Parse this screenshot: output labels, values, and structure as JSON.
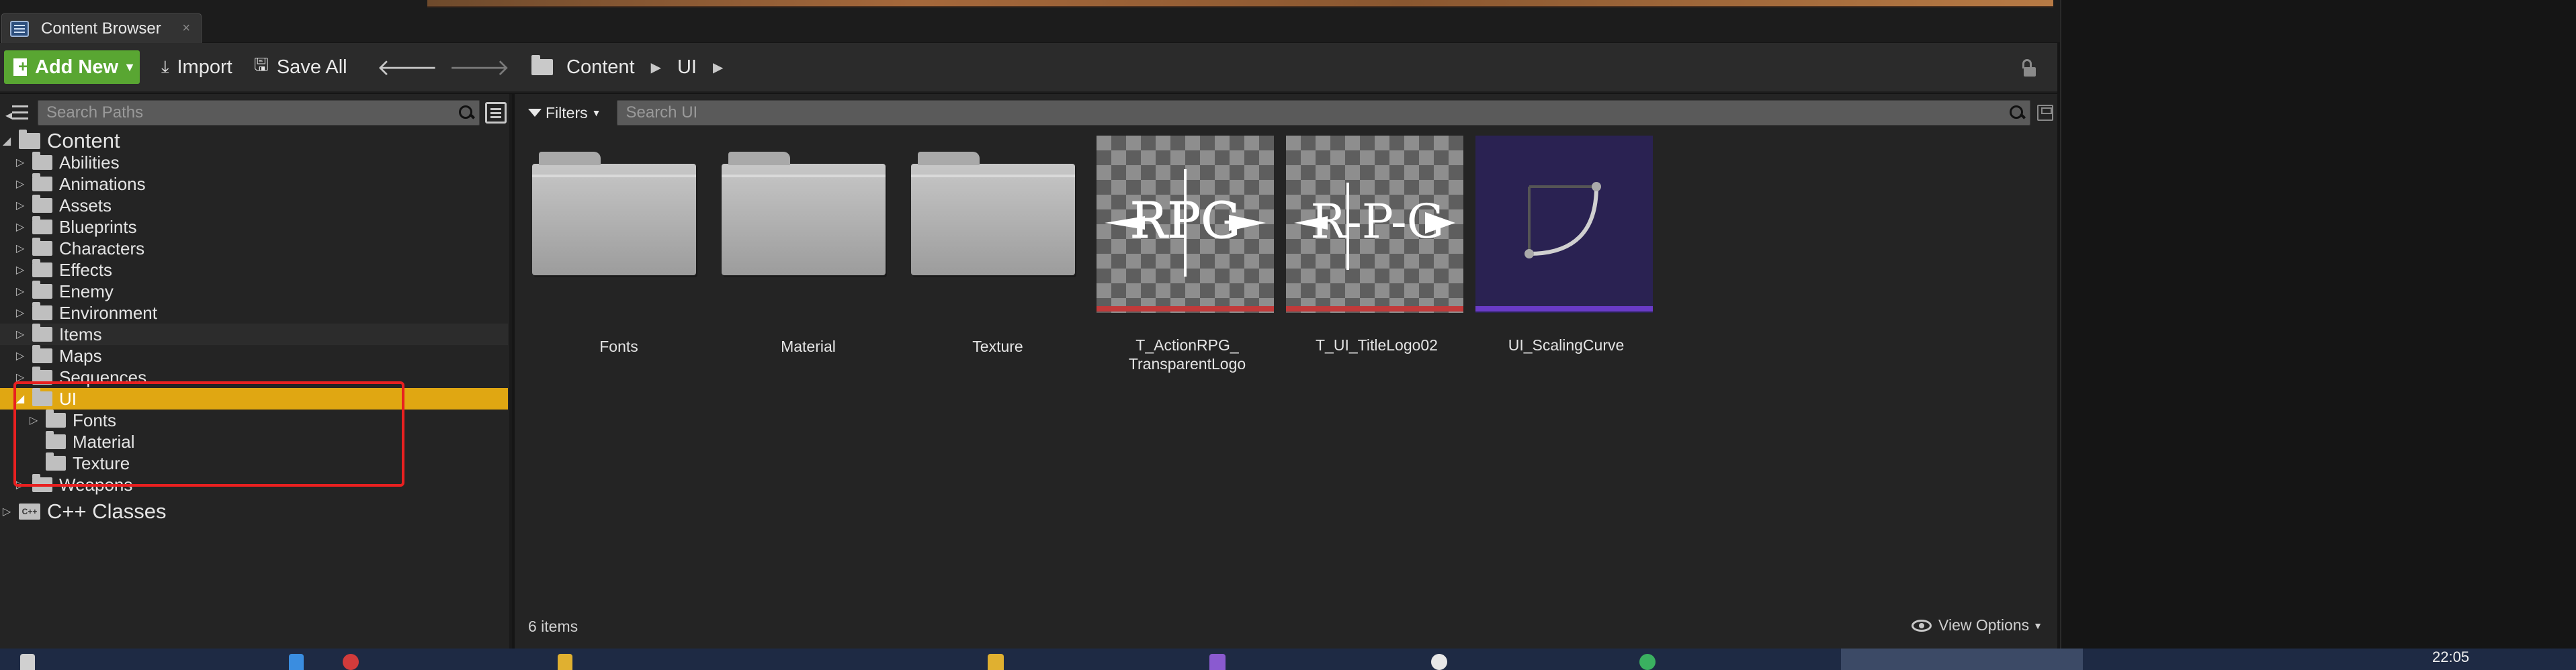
{
  "tab": {
    "title": "Content Browser",
    "close": "×"
  },
  "toolbar": {
    "add_new": "Add New",
    "import": "Import",
    "save_all": "Save All",
    "back": "🡐",
    "forward": "🡒",
    "breadcrumbs": [
      "Content",
      "UI"
    ],
    "crumb_sep": "▶"
  },
  "paths": {
    "search_placeholder": "Search Paths",
    "tree": [
      {
        "label": "Content",
        "level": 0,
        "expanded": true
      },
      {
        "label": "Abilities",
        "level": 1
      },
      {
        "label": "Animations",
        "level": 1
      },
      {
        "label": "Assets",
        "level": 1
      },
      {
        "label": "Blueprints",
        "level": 1
      },
      {
        "label": "Characters",
        "level": 1
      },
      {
        "label": "Effects",
        "level": 1
      },
      {
        "label": "Enemy",
        "level": 1
      },
      {
        "label": "Environment",
        "level": 1
      },
      {
        "label": "Items",
        "level": 1
      },
      {
        "label": "Maps",
        "level": 1
      },
      {
        "label": "Sequences",
        "level": 1
      },
      {
        "label": "UI",
        "level": 1,
        "expanded": true,
        "selected": true
      },
      {
        "label": "Fonts",
        "level": 2
      },
      {
        "label": "Material",
        "level": 2
      },
      {
        "label": "Texture",
        "level": 2
      },
      {
        "label": "Weapons",
        "level": 1
      },
      {
        "label": "C++ Classes",
        "level": 0
      }
    ]
  },
  "assets": {
    "filters_label": "Filters",
    "search_placeholder": "Search UI",
    "items": [
      {
        "name": "Fonts",
        "type": "folder"
      },
      {
        "name": "Material",
        "type": "folder"
      },
      {
        "name": "Texture",
        "type": "folder"
      },
      {
        "name": "T_ActionRPG_\nTransparentLogo",
        "type": "texture"
      },
      {
        "name": "T_UI_TitleLogo02",
        "type": "texture"
      },
      {
        "name": "UI_ScalingCurve",
        "type": "curve"
      }
    ],
    "item_count": "6 items",
    "view_options": "View Options",
    "logo_text": "RPG",
    "logo_alt_text": "R-P-G"
  },
  "taskbar": {
    "time": "22:05"
  },
  "colors": {
    "accent_green": "#59a632",
    "selection": "#e0a712",
    "texture_bar": "#c23a3a",
    "curve_bar": "#6a3bc7"
  }
}
